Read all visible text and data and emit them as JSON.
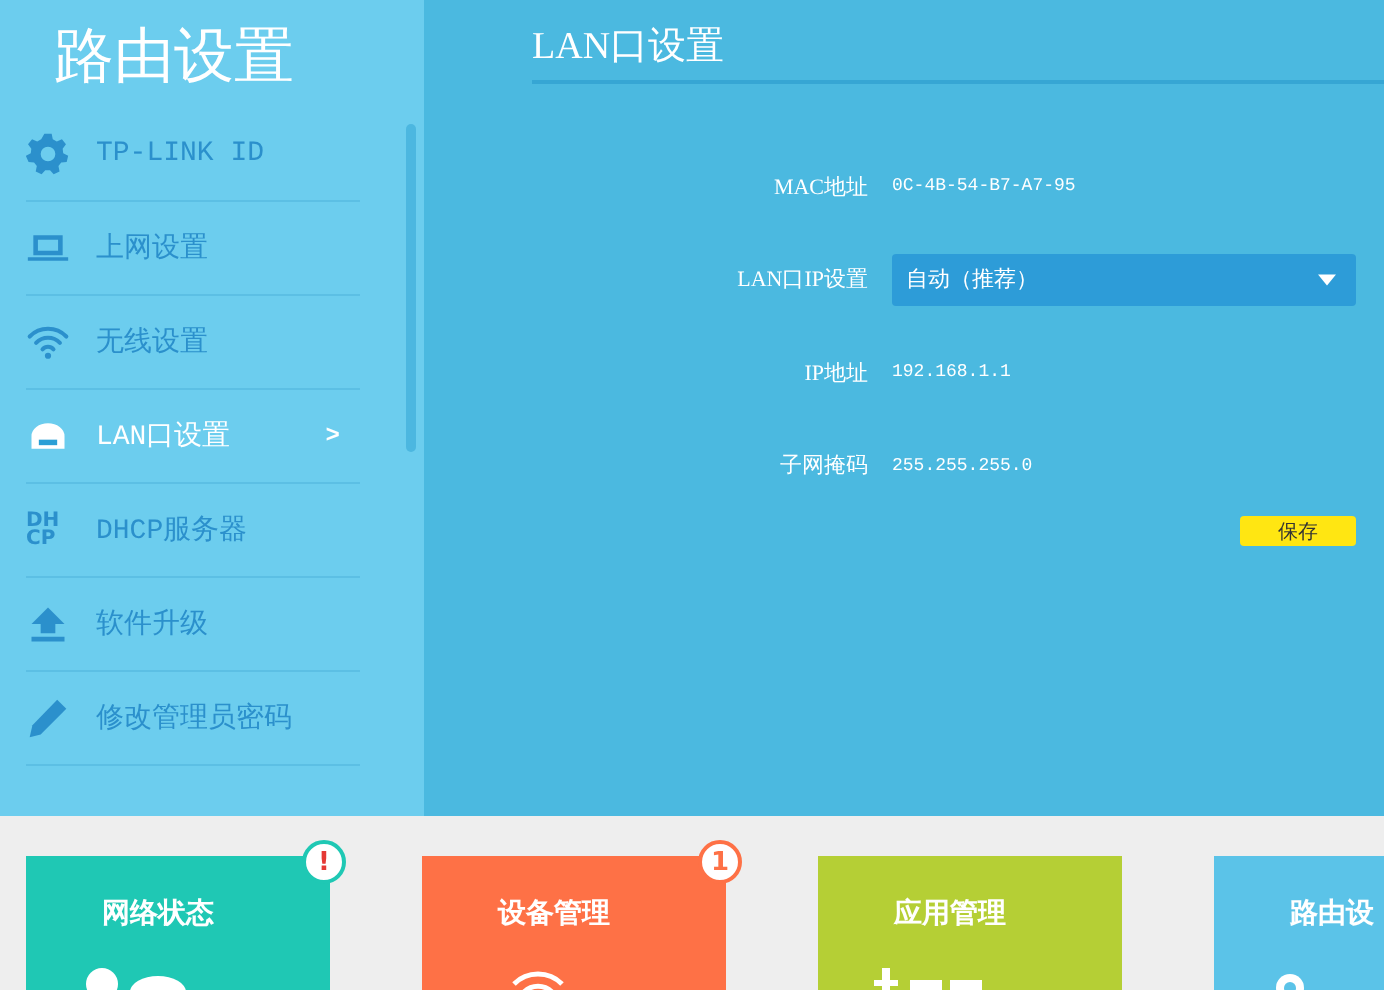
{
  "sidebar": {
    "title": "路由设置",
    "items": [
      {
        "label": "TP-LINK ID",
        "selected": false
      },
      {
        "label": "上网设置",
        "selected": false
      },
      {
        "label": "无线设置",
        "selected": false
      },
      {
        "label": "LAN口设置",
        "selected": true,
        "chevron": ">"
      },
      {
        "label": "DHCP服务器",
        "selected": false,
        "icon_text": "DH CP"
      },
      {
        "label": "软件升级",
        "selected": false
      },
      {
        "label": "修改管理员密码",
        "selected": false
      }
    ]
  },
  "main": {
    "title": "LAN口设置",
    "fields": [
      {
        "kind": "text",
        "label": "MAC地址",
        "value": "0C-4B-54-B7-A7-95"
      },
      {
        "kind": "select",
        "label": "LAN口IP设置",
        "value": "自动（推荐）"
      },
      {
        "kind": "text",
        "label": "IP地址",
        "value": "192.168.1.1"
      },
      {
        "kind": "text",
        "label": "子网掩码",
        "value": "255.255.255.0"
      }
    ],
    "save_button": "保存"
  },
  "tiles": [
    {
      "title": "网络状态",
      "color": "#1fc8b4",
      "badge": {
        "kind": "alert",
        "text": "!"
      }
    },
    {
      "title": "设备管理",
      "color": "#fe7146",
      "badge": {
        "kind": "count",
        "text": "1"
      }
    },
    {
      "title": "应用管理",
      "color": "#b5cf35"
    },
    {
      "title": "路由设",
      "color": "#5bc3e8"
    }
  ]
}
